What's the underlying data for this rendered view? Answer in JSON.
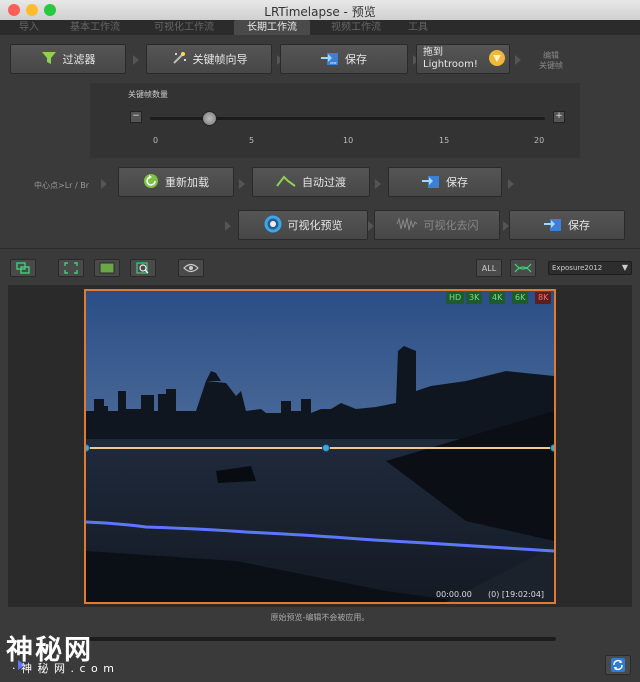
{
  "window": {
    "title": "LRTimelapse - 预览"
  },
  "tabs": [
    {
      "label": "导入"
    },
    {
      "label": "基本工作流"
    },
    {
      "label": "可视化工作流"
    },
    {
      "label": "长期工作流"
    },
    {
      "label": "视频工作流"
    },
    {
      "label": "工具"
    }
  ],
  "row1": {
    "filter": "过滤器",
    "keyframe_wizard": "关键帧向导",
    "save": "保存",
    "drag_line1": "拖到",
    "drag_line2": "Lightroom!",
    "edit_label1": "编辑",
    "edit_label2": "关键帧"
  },
  "keyframes": {
    "label": "关键帧数量",
    "minus": "−",
    "plus": "+",
    "value": 3,
    "max": 20,
    "ticks": [
      "0",
      "5",
      "10",
      "15",
      "20"
    ]
  },
  "row2": {
    "center_label": "中心点>Lr / Br",
    "reload": "重新加载",
    "auto_transition": "自动过渡",
    "save": "保存"
  },
  "row3": {
    "visual_preview": "可视化预览",
    "visual_deflicker": "可视化去闪",
    "save": "保存"
  },
  "toolbar": {
    "all_label": "ALL",
    "exposure_select": "Exposure2012"
  },
  "preview": {
    "badges": [
      "HD",
      "3K",
      "4K",
      "6K",
      "8K"
    ],
    "timecode": "00:00.00",
    "frame_info": "(0)  [19:02:04]",
    "status": "原始预览-编辑不会被应用。"
  },
  "watermark": {
    "main": "神秘网",
    "sub": "· 神 秘 网 . c o m"
  },
  "colors": {
    "accent": "#e07a30",
    "curve_blue": "#5d76ff",
    "keyframe_line": "#f2c98a",
    "keyframe_dot": "#3fa6d8"
  }
}
